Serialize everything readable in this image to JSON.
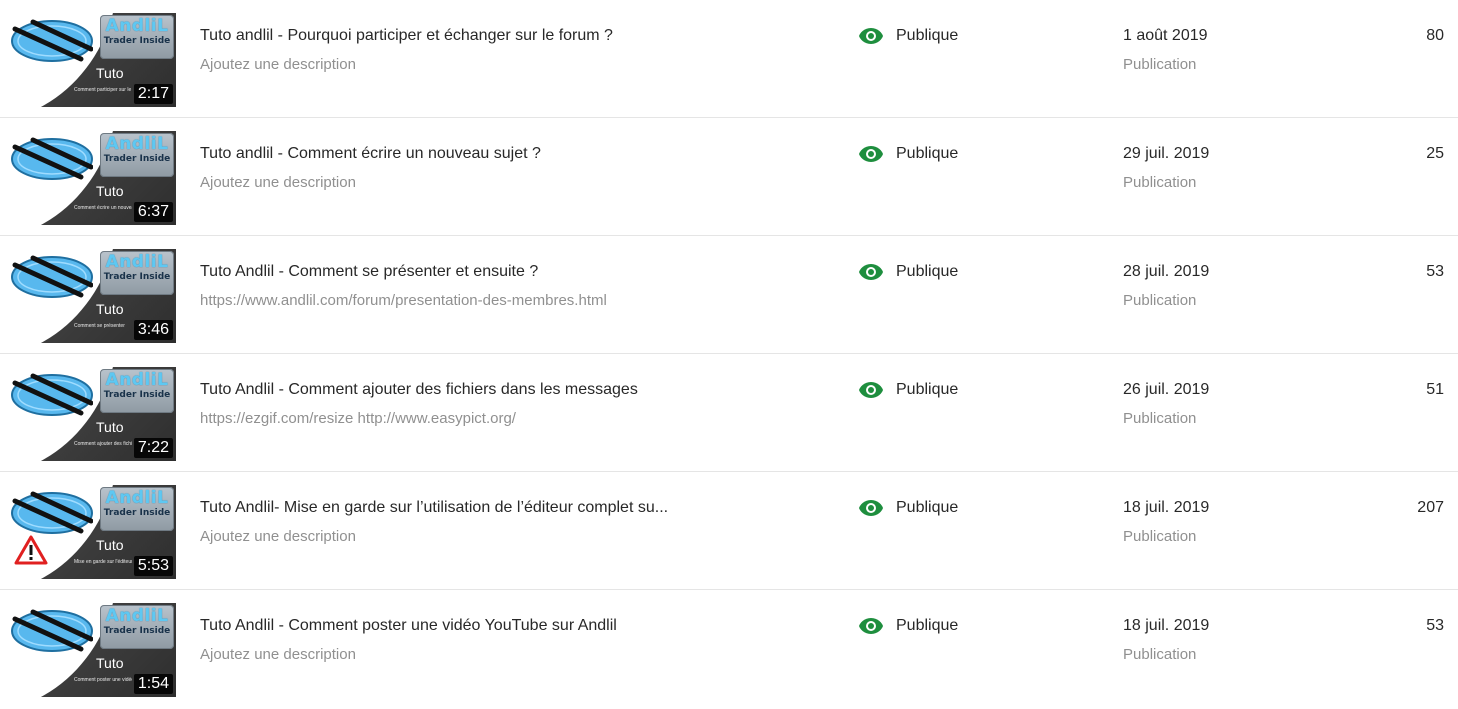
{
  "colors": {
    "eye_icon": "#1e8e3e",
    "divider": "#e5e5e5",
    "secondary_text": "#909090",
    "logo_blue": "#5ec8f2"
  },
  "thumbnail_brand": {
    "logo_main": "AndliL",
    "logo_sub": "Trader Inside",
    "label": "Tuto"
  },
  "videos": [
    {
      "title": "Tuto andlil - Pourquoi participer et échanger sur le forum ?",
      "description": "Ajoutez une description",
      "visibility": "Publique",
      "date": "1 août 2019",
      "date_label": "Publication",
      "views": "80",
      "duration": "2:17",
      "thumb_caption": "Comment participer sur le forum",
      "warning_icon": false
    },
    {
      "title": "Tuto andlil - Comment écrire un nouveau sujet ?",
      "description": "Ajoutez une description",
      "visibility": "Publique",
      "date": "29 juil. 2019",
      "date_label": "Publication",
      "views": "25",
      "duration": "6:37",
      "thumb_caption": "Comment écrire un nouveau sujet",
      "warning_icon": false
    },
    {
      "title": "Tuto Andlil - Comment se présenter et ensuite ?",
      "description": "https://www.andlil.com/forum/presentation-des-membres.html",
      "visibility": "Publique",
      "date": "28 juil. 2019",
      "date_label": "Publication",
      "views": "53",
      "duration": "3:46",
      "thumb_caption": "Comment se présenter",
      "warning_icon": false
    },
    {
      "title": "Tuto Andlil - Comment ajouter des fichiers dans les messages",
      "description": "https://ezgif.com/resize http://www.easypict.org/",
      "visibility": "Publique",
      "date": "26 juil. 2019",
      "date_label": "Publication",
      "views": "51",
      "duration": "7:22",
      "thumb_caption": "Comment ajouter des fichiers dans les messages ?",
      "warning_icon": false
    },
    {
      "title": "Tuto Andlil- Mise en garde sur l’utilisation de l’éditeur complet su...",
      "description": "Ajoutez une description",
      "visibility": "Publique",
      "date": "18 juil. 2019",
      "date_label": "Publication",
      "views": "207",
      "duration": "5:53",
      "thumb_caption": "Mise en garde sur l'éditeur complet",
      "warning_icon": true
    },
    {
      "title": "Tuto Andlil - Comment poster une vidéo YouTube sur Andlil",
      "description": "Ajoutez une description",
      "visibility": "Publique",
      "date": "18 juil. 2019",
      "date_label": "Publication",
      "views": "53",
      "duration": "1:54",
      "thumb_caption": "Comment poster une vidéo",
      "warning_icon": false
    }
  ]
}
